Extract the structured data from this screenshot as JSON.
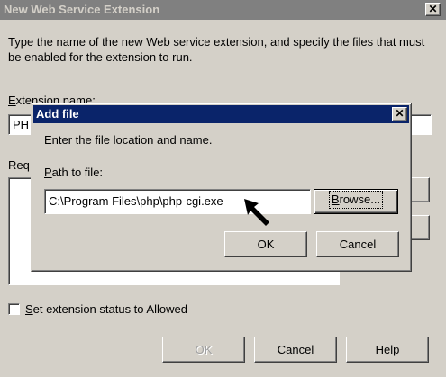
{
  "outer": {
    "title": "New Web Service Extension",
    "close_glyph": "✕",
    "description": "Type the name of the new Web service extension, and specify the files that must be enabled for the extension to run.",
    "ext_name_label_ul": "E",
    "ext_name_label_rest": "xtension name:",
    "ext_name_value": "PH",
    "req_files_label": "Req",
    "allowed_label_ul": "S",
    "allowed_label_rest": "et extension status to Allowed",
    "allowed_checked": false,
    "ok_label": "OK",
    "cancel_label": "Cancel",
    "help_label_ul": "H",
    "help_label_rest": "elp"
  },
  "add_file": {
    "title": "Add file",
    "close_glyph": "✕",
    "description": "Enter the file location and name.",
    "path_label_ul": "P",
    "path_label_rest": "ath to file:",
    "path_value": "C:\\Program Files\\php\\php-cgi.exe",
    "browse_label_ul": "B",
    "browse_label_rest": "rowse...",
    "ok_label": "OK",
    "cancel_label": "Cancel"
  },
  "icons": {
    "arrow": "cursor-arrow-icon"
  }
}
